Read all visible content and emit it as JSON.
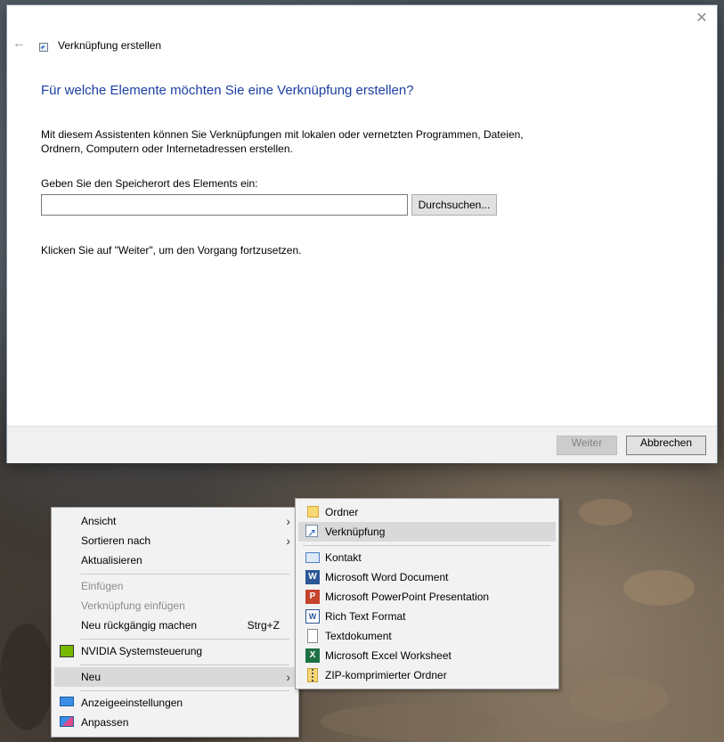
{
  "dialog": {
    "title": "Verknüpfung erstellen",
    "close_glyph": "✕",
    "back_glyph": "←",
    "heading": "Für welche Elemente möchten Sie eine Verknüpfung erstellen?",
    "description": "Mit diesem Assistenten können Sie Verknüpfungen mit lokalen oder vernetzten Programmen, Dateien, Ordnern, Computern oder Internetadressen erstellen.",
    "location_label": "Geben Sie den Speicherort des Elements ein:",
    "location_value": "",
    "browse_label": "Durchsuchen...",
    "hint": "Klicken Sie auf \"Weiter\", um den Vorgang fortzusetzen.",
    "next_label": "Weiter",
    "cancel_label": "Abbrechen"
  },
  "context_menu": {
    "items": [
      {
        "label": "Ansicht",
        "arrow": "›"
      },
      {
        "label": "Sortieren nach",
        "arrow": "›"
      },
      {
        "label": "Aktualisieren"
      },
      {
        "label": "Einfügen",
        "disabled": true
      },
      {
        "label": "Verknüpfung einfügen",
        "disabled": true
      },
      {
        "label": "Neu rückgängig machen",
        "shortcut": "Strg+Z"
      },
      {
        "label": "NVIDIA Systemsteuerung",
        "icon": "nvidia-icon"
      },
      {
        "label": "Neu",
        "arrow": "›",
        "highlighted": true
      },
      {
        "label": "Anzeigeeinstellungen",
        "icon": "display-icon"
      },
      {
        "label": "Anpassen",
        "icon": "customize-icon"
      }
    ]
  },
  "submenu": {
    "items": [
      {
        "label": "Ordner",
        "icon": "folder-icon"
      },
      {
        "label": "Verknüpfung",
        "icon": "shortcut-icon",
        "highlighted": true
      },
      {
        "label": "Kontakt",
        "icon": "contact-icon"
      },
      {
        "label": "Microsoft Word Document",
        "icon": "word-icon",
        "glyph": "W"
      },
      {
        "label": "Microsoft PowerPoint Presentation",
        "icon": "powerpoint-icon",
        "glyph": "P"
      },
      {
        "label": "Rich Text Format",
        "icon": "rtf-icon",
        "glyph": "W"
      },
      {
        "label": "Textdokument",
        "icon": "text-document-icon"
      },
      {
        "label": "Microsoft Excel Worksheet",
        "icon": "excel-icon",
        "glyph": "X"
      },
      {
        "label": "ZIP-komprimierter Ordner",
        "icon": "zip-folder-icon"
      }
    ]
  },
  "colors": {
    "heading": "#1c3fa2",
    "highlight": "#d9d9d9",
    "menu_bg": "#f2f2f2"
  }
}
